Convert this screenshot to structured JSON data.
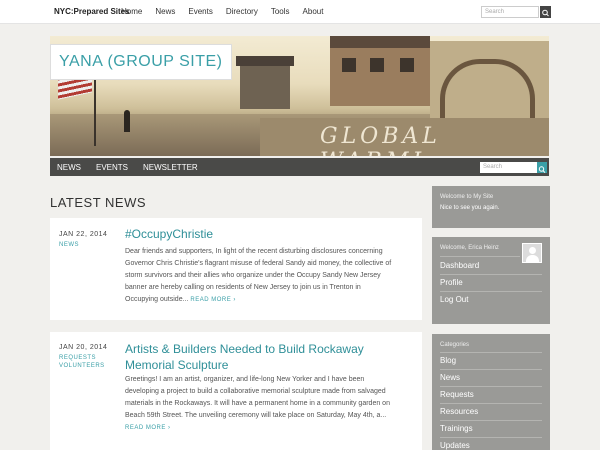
{
  "topbar": {
    "brand": "NYC:Prepared Sites",
    "nav": [
      "Home",
      "News",
      "Events",
      "Directory",
      "Tools",
      "About"
    ],
    "search_placeholder": "Search"
  },
  "header": {
    "site_title": "YANA (GROUP SITE)",
    "graffiti": "GLOBAL WARMI"
  },
  "navbar": {
    "links": [
      "NEWS",
      "EVENTS",
      "NEWSLETTER"
    ],
    "search_placeholder": "Search"
  },
  "main": {
    "heading": "LATEST NEWS",
    "articles": [
      {
        "date": "JAN 22, 2014",
        "categories": [
          "NEWS"
        ],
        "title": "#OccupyChristie",
        "body": "Dear friends and supporters, In light of the recent disturbing disclosures concerning Governor Chris Christie's flagrant misuse of federal Sandy aid money, the collective of storm survivors and their allies who organize under the Occupy Sandy New Jersey banner are hereby calling on residents of New Jersey to join us in Trenton in Occupying outside...",
        "more": "READ MORE ›"
      },
      {
        "date": "JAN 20, 2014",
        "categories": [
          "REQUESTS",
          "VOLUNTEERS"
        ],
        "title": "Artists & Builders Needed to Build Rockaway Memorial Sculpture",
        "body": "Greetings! I am an artist, organizer, and life-long New Yorker and I have been developing a project to build a collaborative memorial sculpture made from salvaged materials in the Rockaways. It will have a permanent home in a community garden on Beach 59th Street. The unveiling ceremony will take place on Saturday, May 4th, a...",
        "more": "READ MORE ›"
      }
    ]
  },
  "sidebar": {
    "welcome": {
      "heading": "Welcome to My Site",
      "text": "Nice to see you again."
    },
    "user": {
      "heading": "Welcome, Erica Heinz",
      "links": [
        "Dashboard",
        "Profile",
        "Log Out"
      ]
    },
    "categories": {
      "heading": "Categories",
      "items": [
        "Blog",
        "News",
        "Requests",
        "Resources",
        "Trainings",
        "Updates"
      ]
    }
  }
}
